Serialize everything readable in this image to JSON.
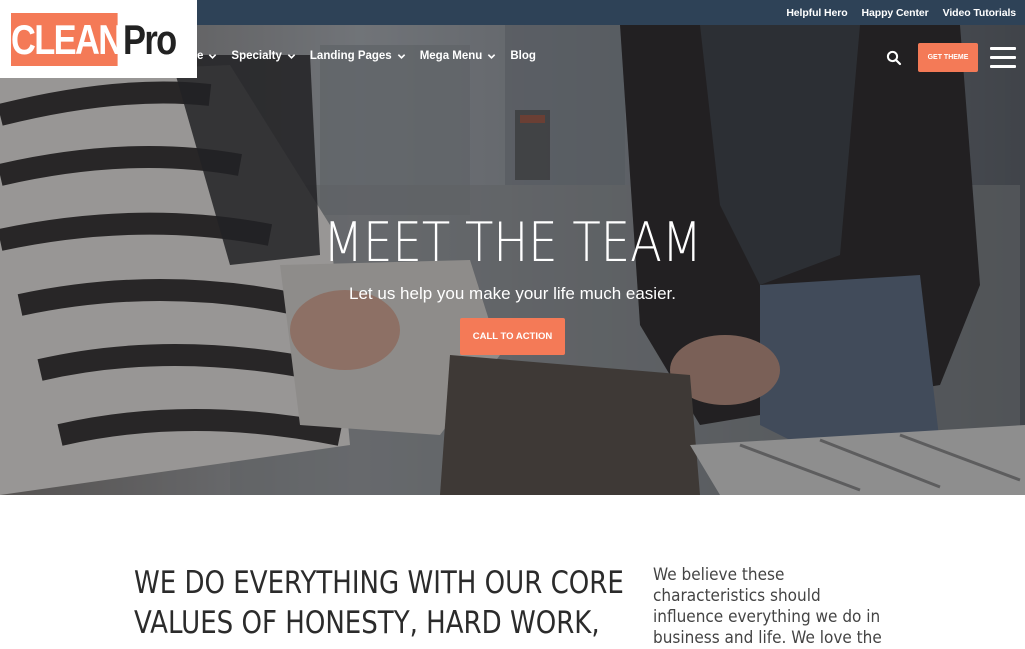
{
  "logo": {
    "part1": "CLEAN",
    "part2": "Pro"
  },
  "utility_links": [
    "Helpful Hero",
    "Happy Center",
    "Video Tutorials"
  ],
  "nav": {
    "partial_item": "e",
    "items": [
      "Specialty",
      "Landing Pages",
      "Mega Menu",
      "Blog"
    ],
    "get_theme_label": "GET THEME",
    "search_icon": "search-icon",
    "menu_icon": "hamburger-menu-icon"
  },
  "hero": {
    "title": "MEET THE TEAM",
    "subtitle": "Let us help you make your life much easier.",
    "cta_label": "CALL TO ACTION"
  },
  "values": {
    "heading": "WE DO EVERYTHING WITH OUR CORE VALUES OF HONESTY, HARD WORK,",
    "body": "We believe these characteristics should influence everything we do in business and life. We love the"
  },
  "colors": {
    "accent": "#f47a57",
    "topbar": "#2e4257",
    "heading_text": "#2b2b2b"
  }
}
